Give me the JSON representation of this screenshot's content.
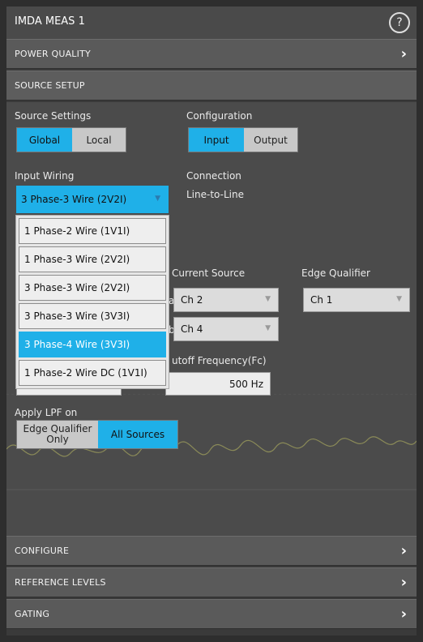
{
  "window": {
    "title": "IMDA MEAS 1",
    "help_icon": "?"
  },
  "sections": {
    "power_quality": "POWER QUALITY",
    "source_setup": "SOURCE SETUP",
    "configure": "CONFIGURE",
    "reference_levels": "REFERENCE LEVELS",
    "gating": "GATING"
  },
  "source_settings": {
    "label": "Source Settings",
    "options": [
      "Global",
      "Local"
    ],
    "selected": "Global"
  },
  "configuration": {
    "label": "Configuration",
    "options": [
      "Input",
      "Output"
    ],
    "selected": "Input"
  },
  "input_wiring": {
    "label": "Input Wiring",
    "value": "3 Phase-3 Wire (2V2I)",
    "menu_options": [
      "1 Phase-2 Wire (1V1I)",
      "1 Phase-3 Wire (2V2I)",
      "3 Phase-3 Wire (2V2I)",
      "3 Phase-3 Wire (3V3I)",
      "3 Phase-4 Wire (3V3I)",
      "1 Phase-2 Wire DC (1V1I)"
    ],
    "highlighted": "3 Phase-4 Wire (3V3I)"
  },
  "connection": {
    "label": "Connection",
    "value": "Line-to-Line"
  },
  "current_source": {
    "label": "Current Source",
    "row1": "Ch 2",
    "row2": "Ch 4",
    "row1_prefix": "a",
    "row2_prefix": "b"
  },
  "edge_qualifier": {
    "label": "Edge Qualifier",
    "value": "Ch 1"
  },
  "cutoff": {
    "label": "utoff Frequency(Fc)",
    "value": "500 Hz"
  },
  "apply_lpf": {
    "label": "Apply LPF on",
    "options": [
      "Edge Qualifier Only",
      "All Sources"
    ],
    "selected": "All Sources"
  },
  "colors": {
    "accent": "#1fb0e8",
    "background": "#4b4b4b",
    "header": "#5a5a5a"
  }
}
